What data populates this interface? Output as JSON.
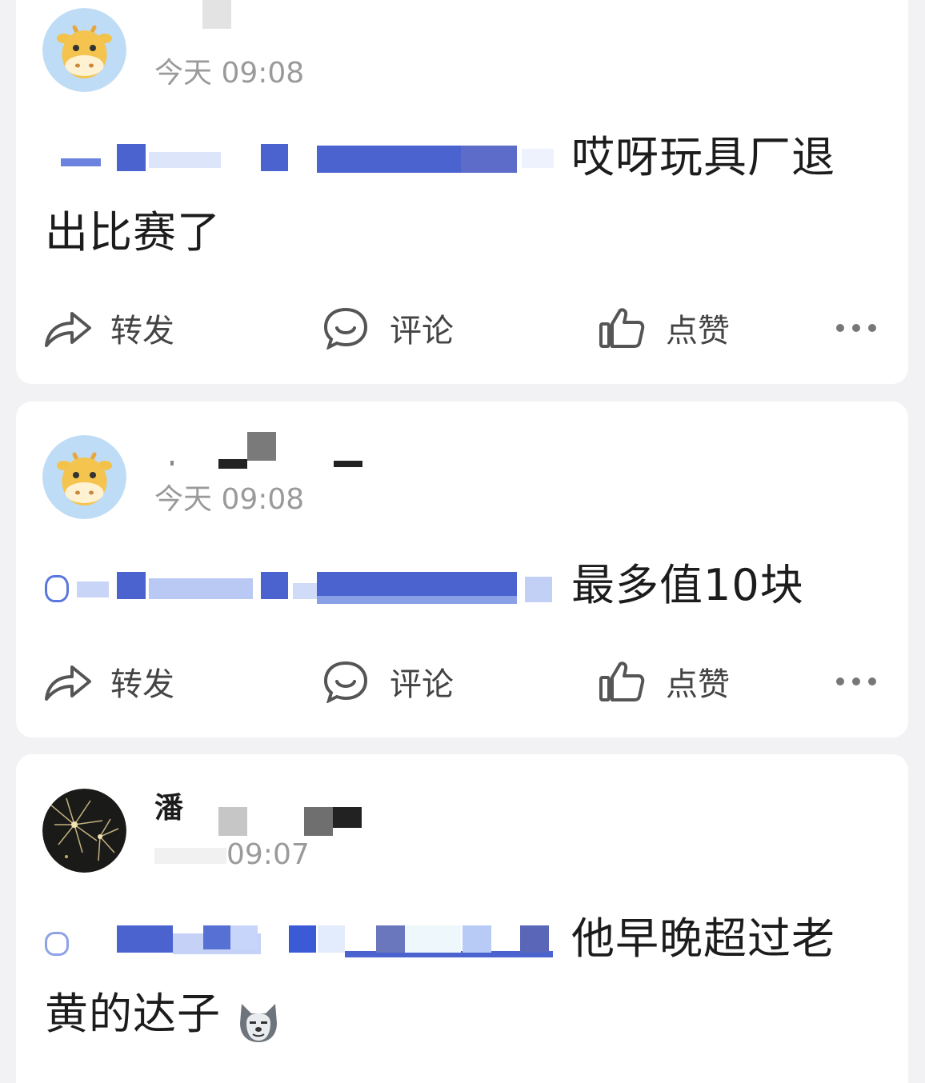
{
  "posts": [
    {
      "time": "今天 09:08",
      "text_prefix": "$ 购料 ... 88833",
      "text": "哎呀玩具厂退出比赛了",
      "actions": {
        "share": "转发",
        "comment": "评论",
        "like": "点赞"
      }
    },
    {
      "time": "今天 09:08",
      "text_prefix": "$ 购料技 ... 888830 $",
      "text": "最多值10块",
      "actions": {
        "share": "转发",
        "comment": "评论",
        "like": "点赞"
      }
    },
    {
      "name": "潘",
      "time": "09:07",
      "text_prefix": "$ 购料技 ... $",
      "text": "他早晚超过老黄的达子",
      "emoji": "husky-emoji"
    }
  ],
  "colors": {
    "link": "#4f6fd9",
    "text": "#1c1c1c",
    "meta": "#9a9a9a",
    "card": "#ffffff",
    "background": "#f2f2f4"
  },
  "icons": [
    "share-icon",
    "comment-icon",
    "like-icon",
    "more-icon",
    "cow-avatar",
    "fireworks-avatar",
    "husky-emoji"
  ]
}
